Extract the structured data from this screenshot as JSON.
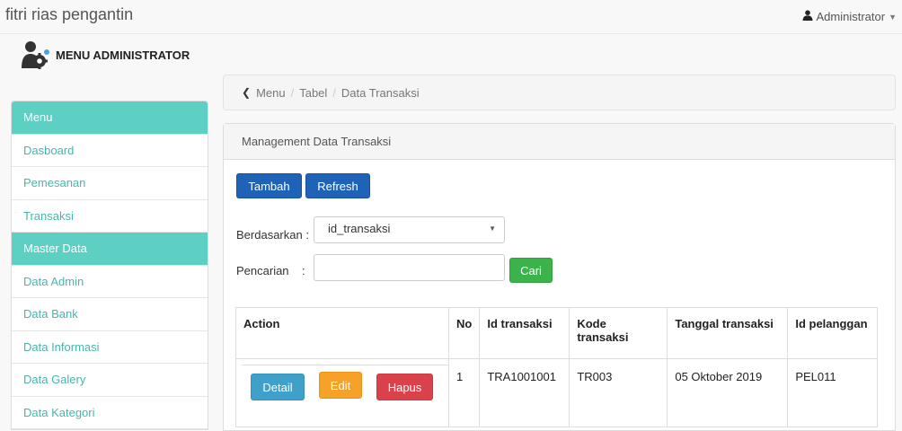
{
  "app": {
    "title": "fitri rias pengantin"
  },
  "user": {
    "name": "Administrator",
    "icon": "user-icon"
  },
  "sidebar": {
    "title": "MENU ADMINISTRATOR",
    "items": [
      {
        "label": "Menu",
        "header": true
      },
      {
        "label": "Dasboard"
      },
      {
        "label": "Pemesanan"
      },
      {
        "label": "Transaksi"
      },
      {
        "label": "Master Data",
        "header": true
      },
      {
        "label": "Data Admin"
      },
      {
        "label": "Data Bank"
      },
      {
        "label": "Data Informasi"
      },
      {
        "label": "Data Galery"
      },
      {
        "label": "Data Kategori"
      }
    ]
  },
  "breadcrumb": {
    "items": [
      "Menu",
      "Tabel",
      "Data Transaksi"
    ]
  },
  "panel": {
    "heading": "Management Data Transaksi"
  },
  "toolbar": {
    "add_label": "Tambah",
    "refresh_label": "Refresh"
  },
  "filter": {
    "by_label": "Berdasarkan",
    "by_value": "id_transaksi",
    "search_label": "Pencarian",
    "search_value": "",
    "search_button": "Cari"
  },
  "table": {
    "headers": [
      "Action",
      "No",
      "Id transaksi",
      "Kode transaksi",
      "Tanggal transaksi",
      "Id pelanggan"
    ],
    "rows": [
      {
        "no": "1",
        "id": "TRA1001001",
        "kode": "TR003",
        "tanggal": "05 Oktober 2019",
        "pelanggan": "PEL011"
      }
    ],
    "actions": {
      "detail": "Detail",
      "edit": "Edit",
      "hapus": "Hapus"
    }
  },
  "colors": {
    "accent": "#5ecfc3",
    "link": "#47b6ad",
    "primary": "#1f63b8"
  }
}
